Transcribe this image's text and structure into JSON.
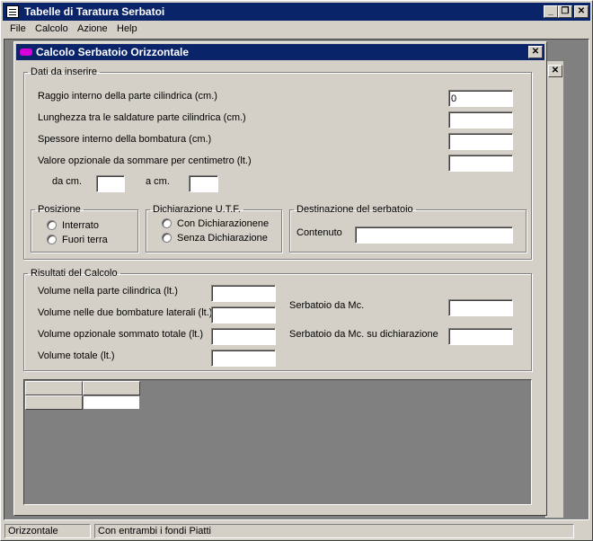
{
  "app": {
    "title": "Tabelle di Taratura Serbatoi",
    "minimize": "_",
    "restore": "❐",
    "close": "✕"
  },
  "menu": [
    "File",
    "Calcolo",
    "Azione",
    "Help"
  ],
  "child": {
    "title": "Calcolo Serbatoio Orizzontale",
    "close": "✕"
  },
  "inputs_group": {
    "legend": "Dati da inserire",
    "fields": [
      {
        "label": "Raggio interno della parte cilindrica (cm.)",
        "value": "0"
      },
      {
        "label": "Lunghezza tra le saldature parte cilindrica (cm.)",
        "value": ""
      },
      {
        "label": "Spessore interno della bombatura (cm.)",
        "value": ""
      },
      {
        "label": "Valore opzionale da sommare per centimetro (lt.)",
        "value": ""
      }
    ],
    "da_cm_label": "da cm.",
    "da_cm_value": "",
    "a_cm_label": "a cm.",
    "a_cm_value": ""
  },
  "posizione": {
    "legend": "Posizione",
    "options": [
      "Interrato",
      "Fuori terra"
    ]
  },
  "dichiarazione": {
    "legend": "Dichiarazione U.T.F.",
    "options": [
      "Con Dichiarazionene",
      "Senza Dichiarazione"
    ]
  },
  "destinazione": {
    "legend": "Destinazione del serbatoio",
    "label": "Contenuto",
    "value": ""
  },
  "risultati": {
    "legend": "Risultati del Calcolo",
    "left": [
      {
        "label": "Volume nella parte cilindrica (lt.)",
        "value": ""
      },
      {
        "label": "Volume nelle due bombature laterali (lt.)",
        "value": ""
      },
      {
        "label": "Volume opzionale sommato totale (lt.)",
        "value": ""
      },
      {
        "label": "Volume totale (lt.)",
        "value": ""
      }
    ],
    "right": [
      {
        "label": "Serbatoio da Mc.",
        "value": ""
      },
      {
        "label": "Serbatoio da Mc. su dichiarazione",
        "value": ""
      }
    ]
  },
  "status": {
    "panel1": "Orizzontale",
    "panel2": "Con entrambi i fondi Piatti"
  }
}
